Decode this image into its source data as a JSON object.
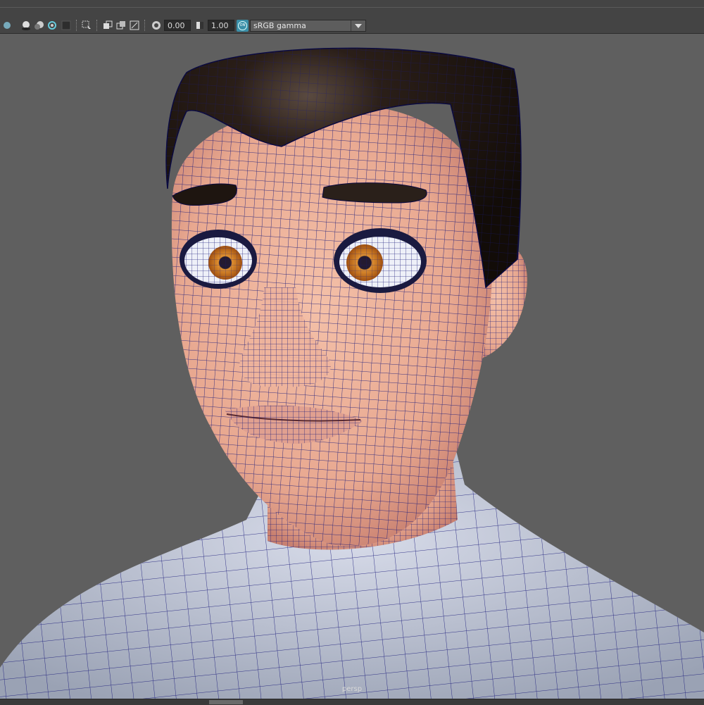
{
  "toolbar": {
    "exposure_value": "0.00",
    "gamma_value": "1.00",
    "color_management_badge": "ON",
    "view_transform": "sRGB gamma",
    "icons": [
      "shadows-icon",
      "ambient-occlusion-icon",
      "motion-blur-icon",
      "anti-aliasing-icon",
      "depth-of-field-icon",
      "isolate-select-icon",
      "xray-icon",
      "xray-active-icon",
      "xray-joints-icon",
      "exposure-icon",
      "gamma-icon",
      "color-management-icon",
      "dropdown-arrow-icon"
    ]
  },
  "viewport": {
    "camera_label": "persp",
    "background_color": "#5f5f5f",
    "wireframe_color": "#1a1a7a",
    "skin_color": "#e8a890",
    "hair_color": "#1e1510",
    "shirt_color": "#b4bccc",
    "iris_color": "#c77a1a"
  }
}
